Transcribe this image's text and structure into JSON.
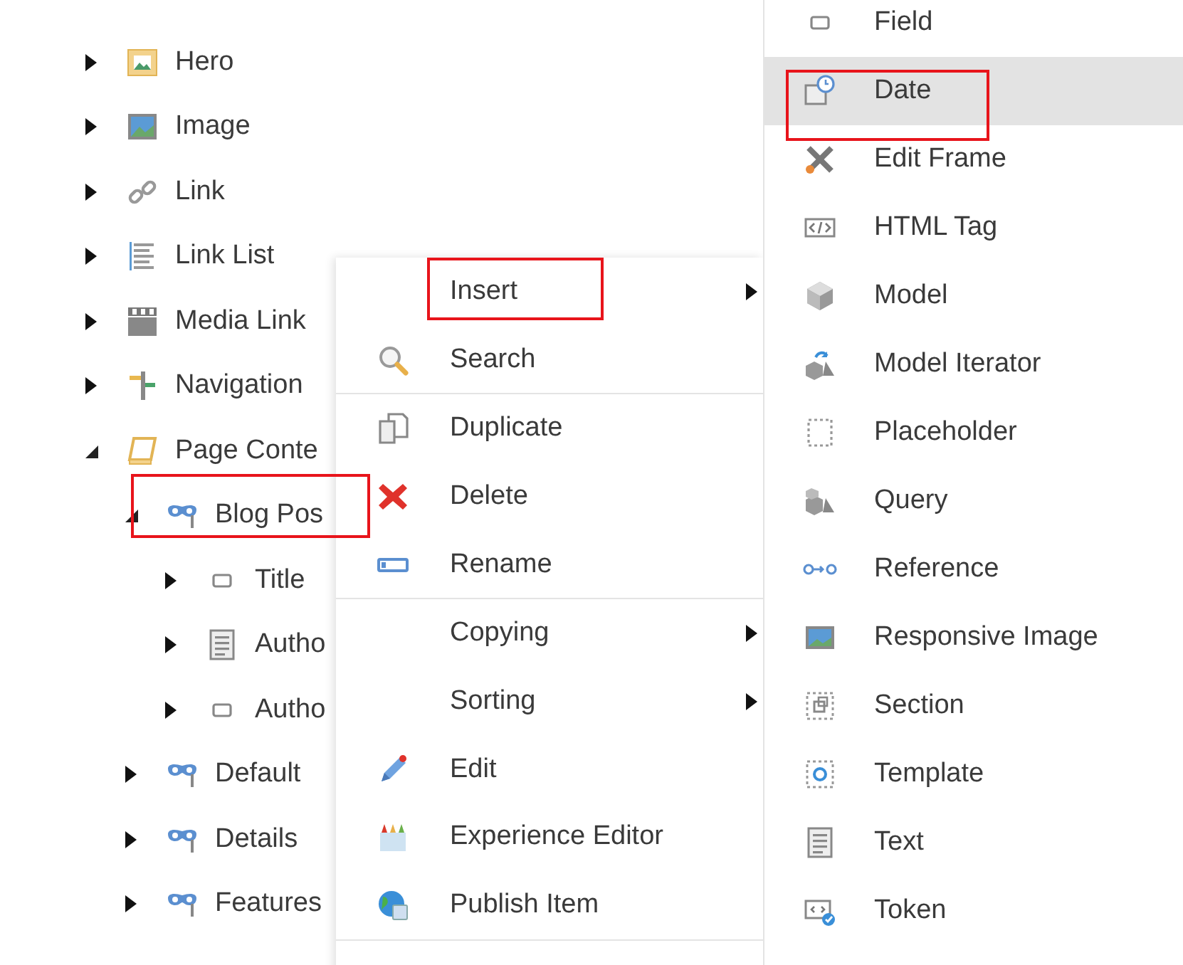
{
  "tree": [
    {
      "label": "Hero",
      "expanded": false,
      "outlined": false
    },
    {
      "label": "Image",
      "expanded": false,
      "outlined": false
    },
    {
      "label": "Link",
      "expanded": false,
      "outlined": false
    },
    {
      "label": "Link List",
      "expanded": false,
      "outlined": false
    },
    {
      "label": "Media Link",
      "expanded": false,
      "outlined": false
    },
    {
      "label": "Navigation",
      "expanded": false,
      "outlined": false
    },
    {
      "label": "Page Conte",
      "expanded": true,
      "outlined": false,
      "children": [
        {
          "label": "Blog Pos",
          "expanded": true,
          "outlined": true,
          "children": [
            {
              "label": "Title",
              "expanded": false,
              "outlined": false
            },
            {
              "label": "Autho",
              "expanded": false,
              "outlined": false
            },
            {
              "label": "Autho",
              "expanded": false,
              "outlined": false
            }
          ]
        },
        {
          "label": "Default",
          "expanded": false,
          "outlined": false
        },
        {
          "label": "Details",
          "expanded": false,
          "outlined": false
        },
        {
          "label": "Features",
          "expanded": false,
          "outlined": false
        }
      ]
    }
  ],
  "context_menu": {
    "groups": [
      [
        {
          "label": "Insert",
          "has_submenu": true,
          "outlined": true
        },
        {
          "label": "Search",
          "has_submenu": false,
          "outlined": false
        }
      ],
      [
        {
          "label": "Duplicate",
          "has_submenu": false,
          "outlined": false
        },
        {
          "label": "Delete",
          "has_submenu": false,
          "outlined": false
        },
        {
          "label": "Rename",
          "has_submenu": false,
          "outlined": false
        }
      ],
      [
        {
          "label": "Copying",
          "has_submenu": true,
          "outlined": false
        },
        {
          "label": "Sorting",
          "has_submenu": true,
          "outlined": false
        },
        {
          "label": "Edit",
          "has_submenu": false,
          "outlined": false
        },
        {
          "label": "Experience Editor",
          "has_submenu": false,
          "outlined": false
        },
        {
          "label": "Publish Item",
          "has_submenu": false,
          "outlined": false
        }
      ]
    ]
  },
  "submenu": {
    "items": [
      {
        "label": "Field",
        "selected": false,
        "outlined": false
      },
      {
        "label": "Date",
        "selected": true,
        "outlined": true
      },
      {
        "label": "Edit Frame",
        "selected": false,
        "outlined": false
      },
      {
        "label": "HTML Tag",
        "selected": false,
        "outlined": false
      },
      {
        "label": "Model",
        "selected": false,
        "outlined": false
      },
      {
        "label": "Model Iterator",
        "selected": false,
        "outlined": false
      },
      {
        "label": "Placeholder",
        "selected": false,
        "outlined": false
      },
      {
        "label": "Query",
        "selected": false,
        "outlined": false
      },
      {
        "label": "Reference",
        "selected": false,
        "outlined": false
      },
      {
        "label": "Responsive Image",
        "selected": false,
        "outlined": false
      },
      {
        "label": "Section",
        "selected": false,
        "outlined": false
      },
      {
        "label": "Template",
        "selected": false,
        "outlined": false
      },
      {
        "label": "Text",
        "selected": false,
        "outlined": false
      },
      {
        "label": "Token",
        "selected": false,
        "outlined": false
      }
    ]
  }
}
